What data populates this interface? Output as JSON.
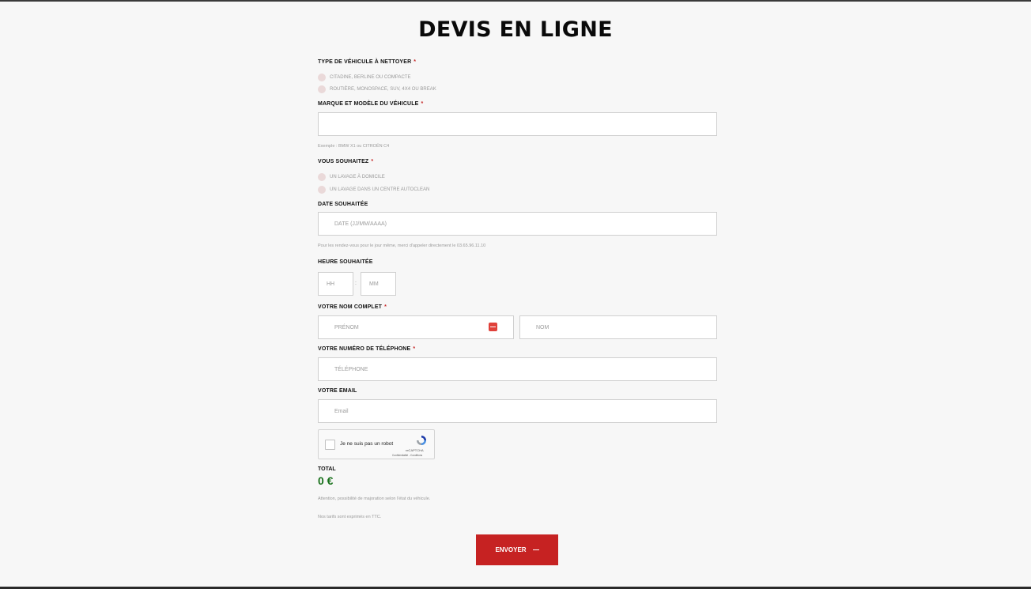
{
  "page": {
    "title": "DEVIS EN LIGNE"
  },
  "vehicle_type": {
    "label": "TYPE DE VÉHICULE À NETTOYER",
    "required_mark": "*",
    "options": [
      "CITADINE, BERLINE OU COMPACTE",
      "ROUTIÈRE, MONOSPACE, SUV, 4X4 OU BREAK"
    ]
  },
  "model": {
    "label": "MARQUE ET MODÈLE DU VÉHICULE",
    "required_mark": "*",
    "value": "",
    "hint": "Exemple : BMW X1 ou CITROËN C4"
  },
  "wish": {
    "label": "VOUS SOUHAITEZ",
    "required_mark": "*",
    "options": [
      "UN LAVAGE À DOMICILE",
      "UN LAVAGE DANS UN CENTRE AUTOCLEAN"
    ]
  },
  "date": {
    "label": "DATE SOUHAITÉE",
    "placeholder": "DATE (JJ/MM/AAAA)",
    "hint": "Pour les rendez-vous pour le jour même, merci d'appeler directement le 03.65.96.11.10"
  },
  "time": {
    "label": "HEURE SOUHAITÉE",
    "hours_placeholder": "HH",
    "separator": ":",
    "minutes_placeholder": "MM"
  },
  "name": {
    "label": "VOTRE NOM COMPLET",
    "required_mark": "*",
    "first_placeholder": "PRÉNOM",
    "last_placeholder": "NOM"
  },
  "phone": {
    "label": "VOTRE NUMÉRO DE TÉLÉPHONE",
    "required_mark": "*",
    "placeholder": "TÉLÉPHONE"
  },
  "email": {
    "label": "VOTRE EMAIL",
    "placeholder": "Email"
  },
  "recaptcha": {
    "text": "Je ne suis pas un robot",
    "brand": "reCAPTCHA",
    "terms": "Confidentialité - Conditions"
  },
  "total": {
    "label": "TOTAL",
    "value": "0 €",
    "note_1": "Attention, possibilité de majoration selon l'état du véhicule.",
    "note_2": "Nos tarifs sont exprimés en TTC."
  },
  "submit": {
    "label": "ENVOYER"
  },
  "colors": {
    "accent": "#c62222",
    "total_green": "#17701a",
    "background": "#f7f7f7"
  }
}
